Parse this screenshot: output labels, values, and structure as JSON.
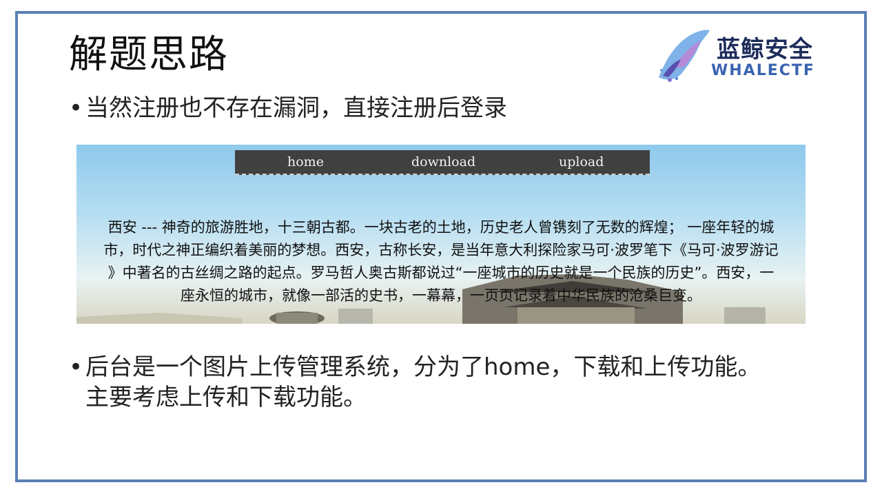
{
  "slide": {
    "title": "解题思路",
    "logo": {
      "cn": "蓝鲸安全",
      "en": "WHALECTF",
      "icon": "whale-icon"
    },
    "bullets": [
      {
        "text": "当然注册也不存在漏洞，直接注册后登录"
      },
      {
        "line1": "后台是一个图片上传管理系统，分为了home，下载和上传功能。",
        "line2": "主要考虑上传和下载功能。"
      }
    ]
  },
  "screenshot": {
    "nav": [
      "home",
      "download",
      "upload"
    ],
    "intro_lines": [
      "西安 --- 神奇的旅游胜地，十三朝古都。一块古老的土地，历史老人曾镌刻了无数的辉煌；  一座年轻的城",
      "市，时代之神正编织着美丽的梦想。西安，古称长安，是当年意大利探险家马可·波罗笔下《马可·波罗游记",
      "》中著名的古丝绸之路的起点。罗马哲人奥古斯都说过“一座城市的历史就是一个民族的历史”。西安，一",
      "座永恒的城市，就像一部活的史书，一幕幕，一页页记录着中华民族的沧桑巨变。"
    ]
  },
  "colors": {
    "frame": "#5b7fb3",
    "nav_bg": "#404040",
    "logo_cn": "#1d2b5a",
    "logo_en": "#3a63b0"
  }
}
